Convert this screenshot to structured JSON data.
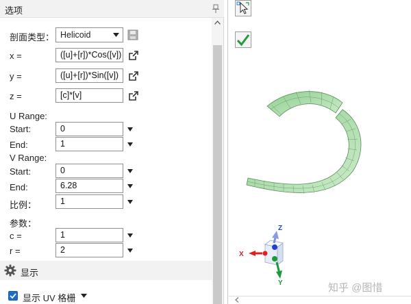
{
  "panel": {
    "title": "选项",
    "profile_type_label": "剖面类型：",
    "profile_type_value": "Helicoid",
    "x_label": "x =",
    "x_value": "([u]+[r])*Cos([v])",
    "y_label": "y =",
    "y_value": "([u]+[r])*Sin([v])",
    "z_label": "z =",
    "z_value": "[c]*[v]",
    "u_range_label": "U Range:",
    "u_start_label": "Start:",
    "u_start_value": "0",
    "u_end_label": "End:",
    "u_end_value": "1",
    "v_range_label": "V Range:",
    "v_start_label": "Start:",
    "v_start_value": "0",
    "v_end_label": "End:",
    "v_end_value": "6.28",
    "scale_label": "比例：",
    "scale_value": "1",
    "params_label": "参数：",
    "c_label": "c =",
    "c_value": "1",
    "r_label": "r =",
    "r_value": "2",
    "display_label": "显示",
    "show_uv_grid_label": "显示 UV 格栅"
  },
  "view": {
    "axis_x": "X",
    "axis_y": "Y",
    "axis_z": "Z",
    "watermark": "知乎 @图惜"
  },
  "colors": {
    "surface": "#a8d8a8",
    "grid": "#5a8a5a",
    "axis_x": "#e02020",
    "axis_y": "#1a9a3a",
    "axis_z": "#2040d0",
    "checkbox": "#1a6fc4"
  },
  "icons": [
    "pin-icon",
    "save-icon",
    "external-link-icon",
    "dropdown-arrow-icon",
    "gear-icon",
    "select-tool-icon",
    "checkmark-icon"
  ]
}
